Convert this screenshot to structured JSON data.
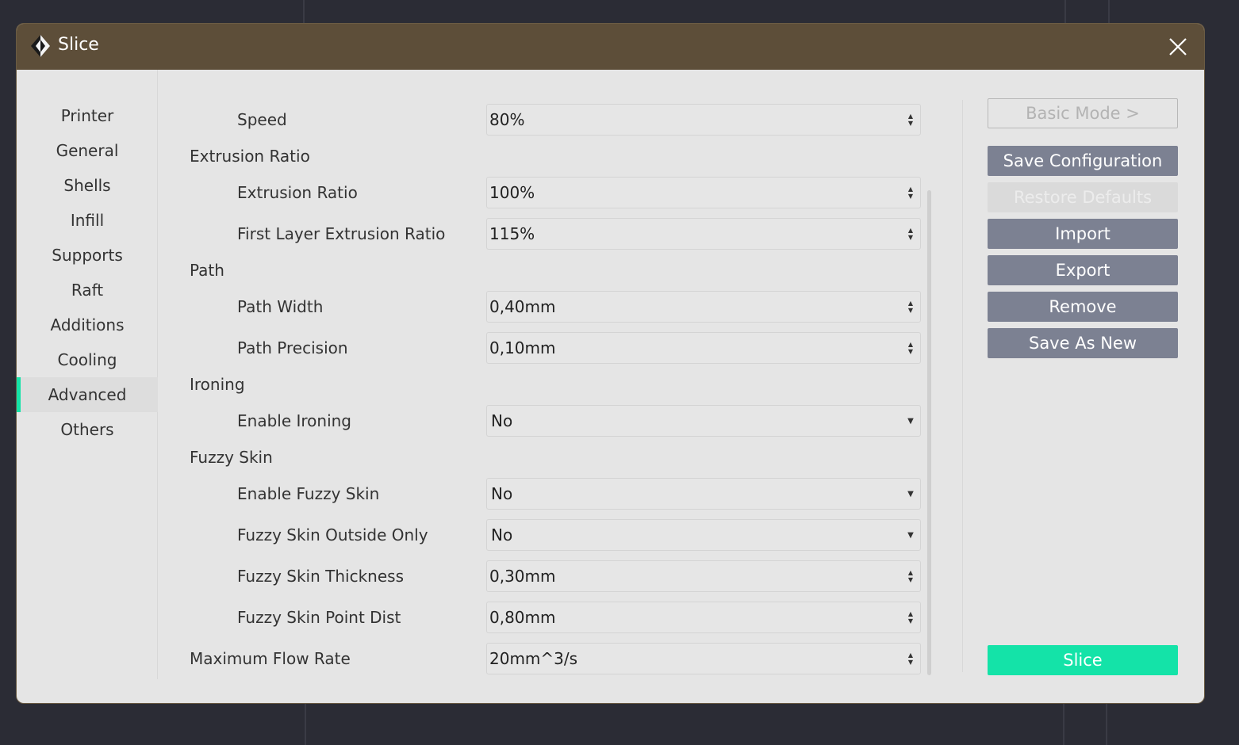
{
  "dialog": {
    "title": "Slice"
  },
  "nav": {
    "items": [
      {
        "label": "Printer",
        "active": false
      },
      {
        "label": "General",
        "active": false
      },
      {
        "label": "Shells",
        "active": false
      },
      {
        "label": "Infill",
        "active": false
      },
      {
        "label": "Supports",
        "active": false
      },
      {
        "label": "Raft",
        "active": false
      },
      {
        "label": "Additions",
        "active": false
      },
      {
        "label": "Cooling",
        "active": false
      },
      {
        "label": "Advanced",
        "active": true
      },
      {
        "label": "Others",
        "active": false
      }
    ]
  },
  "settings": {
    "speed": {
      "label": "Speed",
      "value": "80%"
    },
    "extrusion_ratio_header": "Extrusion Ratio",
    "extrusion_ratio": {
      "label": "Extrusion Ratio",
      "value": "100%"
    },
    "first_layer_extrusion_ratio": {
      "label": "First Layer Extrusion Ratio",
      "value": "115%"
    },
    "path_header": "Path",
    "path_width": {
      "label": "Path Width",
      "value": "0,40mm"
    },
    "path_precision": {
      "label": "Path Precision",
      "value": "0,10mm"
    },
    "ironing_header": "Ironing",
    "enable_ironing": {
      "label": "Enable Ironing",
      "value": "No"
    },
    "fuzzy_skin_header": "Fuzzy Skin",
    "enable_fuzzy_skin": {
      "label": "Enable Fuzzy Skin",
      "value": "No"
    },
    "fuzzy_skin_outside_only": {
      "label": "Fuzzy Skin Outside Only",
      "value": "No"
    },
    "fuzzy_skin_thickness": {
      "label": "Fuzzy Skin Thickness",
      "value": "0,30mm"
    },
    "fuzzy_skin_point_dist": {
      "label": "Fuzzy Skin Point Dist",
      "value": "0,80mm"
    },
    "maximum_flow_rate": {
      "label": "Maximum Flow Rate",
      "value": "20mm^3/s"
    }
  },
  "actions": {
    "basic_mode": "Basic Mode >",
    "save_configuration": "Save Configuration",
    "restore_defaults": "Restore Defaults",
    "import": "Import",
    "export": "Export",
    "remove": "Remove",
    "save_as_new": "Save As New",
    "slice": "Slice"
  },
  "colors": {
    "titlebar": "#5d4e39",
    "accent": "#14e3a8",
    "button": "#7c8192"
  }
}
